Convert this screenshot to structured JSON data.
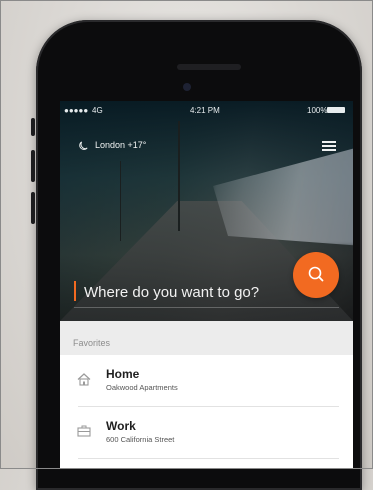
{
  "status_bar": {
    "signal": "●●●●● ",
    "carrier": "4G",
    "time": "4:21 PM",
    "battery": "100%"
  },
  "header": {
    "weather": "London +17°",
    "weather_icon": "moon-icon",
    "menu_icon": "hamburger-menu-icon"
  },
  "search": {
    "placeholder": "Where do you want to go?",
    "button_icon": "search-icon",
    "accent_color": "#f26a21"
  },
  "favorites": {
    "header": "Favorites",
    "items": [
      {
        "title": "Home",
        "subtitle": "Oakwood Apartments",
        "icon": "home-icon"
      },
      {
        "title": "Work",
        "subtitle": "600 California Street",
        "icon": "briefcase-icon"
      }
    ]
  }
}
